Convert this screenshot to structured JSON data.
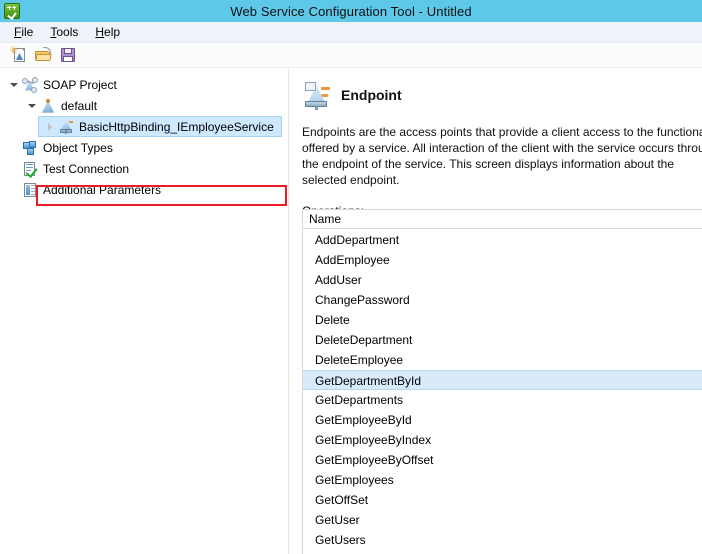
{
  "window": {
    "title": "Web Service Configuration Tool - Untitled",
    "icon": "app-icon",
    "titlebar_color": "#5ec8e8"
  },
  "menubar": {
    "items": [
      {
        "accel": "F",
        "rest": "ile"
      },
      {
        "accel": "T",
        "rest": "ools"
      },
      {
        "accel": "H",
        "rest": "elp"
      }
    ]
  },
  "toolbar": {
    "buttons": [
      {
        "name": "new-file-icon",
        "tooltip": "New"
      },
      {
        "name": "open-folder-icon",
        "tooltip": "Open"
      },
      {
        "name": "save-icon",
        "tooltip": "Save"
      }
    ]
  },
  "tree": {
    "nodes": [
      {
        "label": "SOAP Project",
        "icon": "soap-project-icon",
        "level": 1,
        "expander": "open",
        "selected": false
      },
      {
        "label": "default",
        "icon": "default-binding-icon",
        "level": 2,
        "expander": "open",
        "selected": false
      },
      {
        "label": "BasicHttpBinding_IEmployeeService",
        "icon": "endpoint-binding-icon",
        "level": 3,
        "expander": "collapsed",
        "selected": true
      },
      {
        "label": "Object Types",
        "icon": "object-types-icon",
        "level": 0,
        "expander": "none",
        "selected": false
      },
      {
        "label": "Test Connection",
        "icon": "test-connection-icon",
        "level": 0,
        "expander": "none",
        "selected": false
      },
      {
        "label": "Additional Parameters",
        "icon": "additional-parameters-icon",
        "level": 0,
        "expander": "none",
        "selected": false
      }
    ],
    "annotation": {
      "name": "red-highlight-box",
      "color": "#ec1c24"
    }
  },
  "detail": {
    "icon": "endpoint-icon",
    "title": "Endpoint",
    "description": "Endpoints are the access points that provide a client access to the functionality offered by a service. All interaction of the client with the service occurs through the endpoint of the service. This screen displays information about the selected endpoint.",
    "operations_label_accel": "O",
    "operations_label_rest": "perations:",
    "column_header": "Name",
    "selected_operation": "GetDepartmentById",
    "operations": [
      "AddDepartment",
      "AddEmployee",
      "AddUser",
      "ChangePassword",
      "Delete",
      "DeleteDepartment",
      "DeleteEmployee",
      "GetDepartmentById",
      "GetDepartments",
      "GetEmployeeById",
      "GetEmployeeByIndex",
      "GetEmployeeByOffset",
      "GetEmployees",
      "GetOffSet",
      "GetUser",
      "GetUsers"
    ]
  }
}
